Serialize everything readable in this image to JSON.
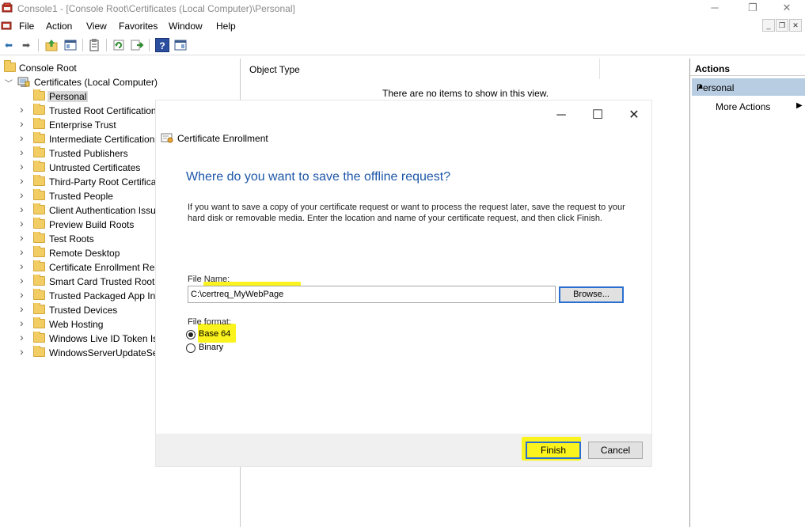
{
  "window": {
    "title": "Console1 - [Console Root\\Certificates (Local Computer)\\Personal]",
    "minimize_glyph": "─",
    "restore_glyph": "❐",
    "close_glyph": "✕"
  },
  "menu": {
    "items": [
      "File",
      "Action",
      "View",
      "Favorites",
      "Window",
      "Help"
    ]
  },
  "toolbar": {
    "back_glyph": "⬅",
    "forward_glyph": "➡",
    "help_glyph": "?"
  },
  "tree": {
    "root": "Console Root",
    "computer": "Certificates (Local Computer)",
    "items": [
      "Personal",
      "Trusted Root Certification",
      "Enterprise Trust",
      "Intermediate Certification",
      "Trusted Publishers",
      "Untrusted Certificates",
      "Third-Party Root Certifica",
      "Trusted People",
      "Client Authentication Issu",
      "Preview Build Roots",
      "Test Roots",
      "Remote Desktop",
      "Certificate Enrollment Rec",
      "Smart Card Trusted Roots",
      "Trusted Packaged App Ins",
      "Trusted Devices",
      "Web Hosting",
      "Windows Live ID Token Iss",
      "WindowsServerUpdateSer"
    ]
  },
  "list": {
    "column_header": "Object Type",
    "empty_message": "There are no items to show in this view."
  },
  "actions": {
    "header": "Actions",
    "section": "Personal",
    "more_actions": "More Actions"
  },
  "dialog": {
    "title": "Certificate Enrollment",
    "heading": "Where do you want to save the offline request?",
    "description": "If you want to save a copy of your certificate request or want to process the request later, save the request to your hard disk or removable media. Enter the location and name of your certificate request, and then click Finish.",
    "file_name_label": "File Name:",
    "file_name_value": "C:\\certreq_MyWebPage",
    "browse_label": "Browse...",
    "file_format_label": "File format:",
    "format_options": [
      {
        "label": "Base 64",
        "checked": true
      },
      {
        "label": "Binary",
        "checked": false
      }
    ],
    "finish_label": "Finish",
    "cancel_label": "Cancel"
  },
  "colors": {
    "highlight": "#fbf31d",
    "heading_blue": "#1d56a8",
    "focus_blue": "#2a6fd0",
    "actions_band": "#b8cde2"
  }
}
